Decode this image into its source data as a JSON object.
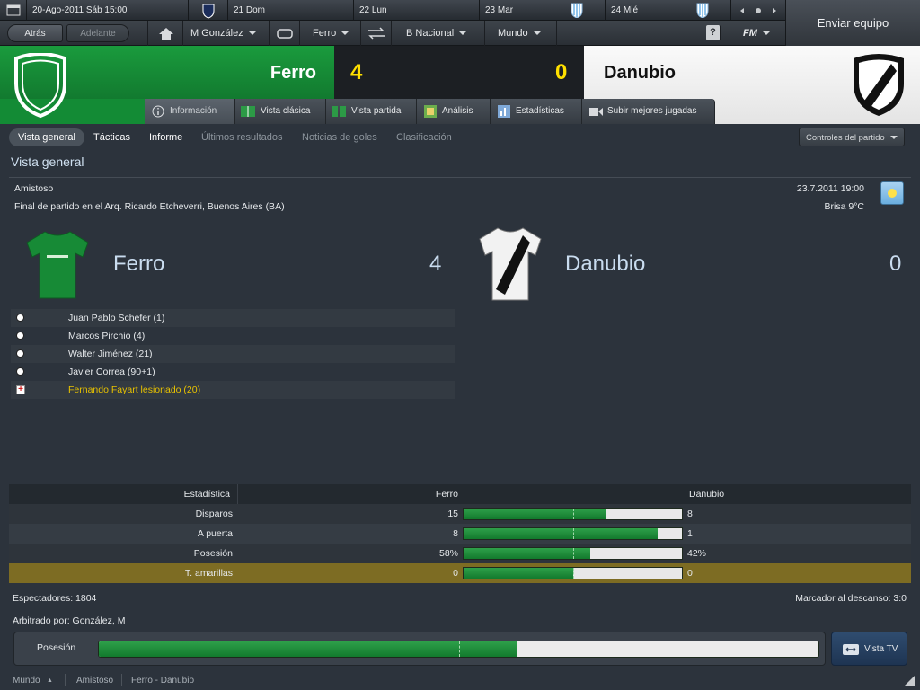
{
  "topbar": {
    "date": "20-Ago-2011 Sáb 15:00",
    "days": [
      "21 Dom",
      "22 Lun",
      "23 Mar",
      "24 Mié"
    ],
    "send_button": "Enviar equipo"
  },
  "nav": {
    "back": "Atrás",
    "forward": "Adelante",
    "manager": "M González",
    "club": "Ferro",
    "competition": "B Nacional",
    "world": "Mundo",
    "help": "?",
    "fm": "FM"
  },
  "match": {
    "home_team": "Ferro",
    "away_team": "Danubio",
    "home_score": "4",
    "away_score": "0"
  },
  "tabs": [
    "Información",
    "Vista clásica",
    "Vista partida",
    "Análisis",
    "Estadísticas",
    "Subir mejores jugadas"
  ],
  "subtabs": [
    "Vista general",
    "Tácticas",
    "Informe",
    "Últimos resultados",
    "Noticias de goles",
    "Clasificación"
  ],
  "match_controls": "Controles del partido",
  "section_title": "Vista general",
  "info": {
    "competition": "Amistoso",
    "venue": "Final de partido en el Arq. Ricardo Etcheverri, Buenos Aires (BA)",
    "datetime": "23.7.2011 19:00",
    "weather": "Brisa 9°C"
  },
  "events": [
    {
      "text": "Juan Pablo Schefer (1)",
      "type": "goal"
    },
    {
      "text": "Marcos Pirchio (4)",
      "type": "goal"
    },
    {
      "text": "Walter Jiménez (21)",
      "type": "goal"
    },
    {
      "text": "Javier Correa (90+1)",
      "type": "goal"
    },
    {
      "text": "Fernando Fayart lesionado (20)",
      "type": "injury"
    }
  ],
  "stats": {
    "header": {
      "label": "Estadística",
      "home": "Ferro",
      "away": "Danubio"
    },
    "rows": [
      {
        "label": "Disparos",
        "home": "15",
        "away": "8",
        "home_share": 0.652
      },
      {
        "label": "A puerta",
        "home": "8",
        "away": "1",
        "home_share": 0.889
      },
      {
        "label": "Posesión",
        "home": "58%",
        "away": "42%",
        "home_share": 0.58
      },
      {
        "label": "T. amarillas",
        "home": "0",
        "away": "0",
        "home_share": 0.5
      }
    ]
  },
  "spectators": "Espectadores: 1804",
  "halftime": "Marcador al descanso: 3:0",
  "referee": "Arbitrado por: González, M",
  "possession_label": "Posesión",
  "possession_home": 0.58,
  "tv_button": "Vista TV",
  "breadcrumb": [
    "Mundo",
    "Amistoso",
    "Ferro - Danubio"
  ],
  "colors": {
    "home": "#17993a",
    "score": "#ffe000",
    "highlight": "#7d6c23"
  }
}
